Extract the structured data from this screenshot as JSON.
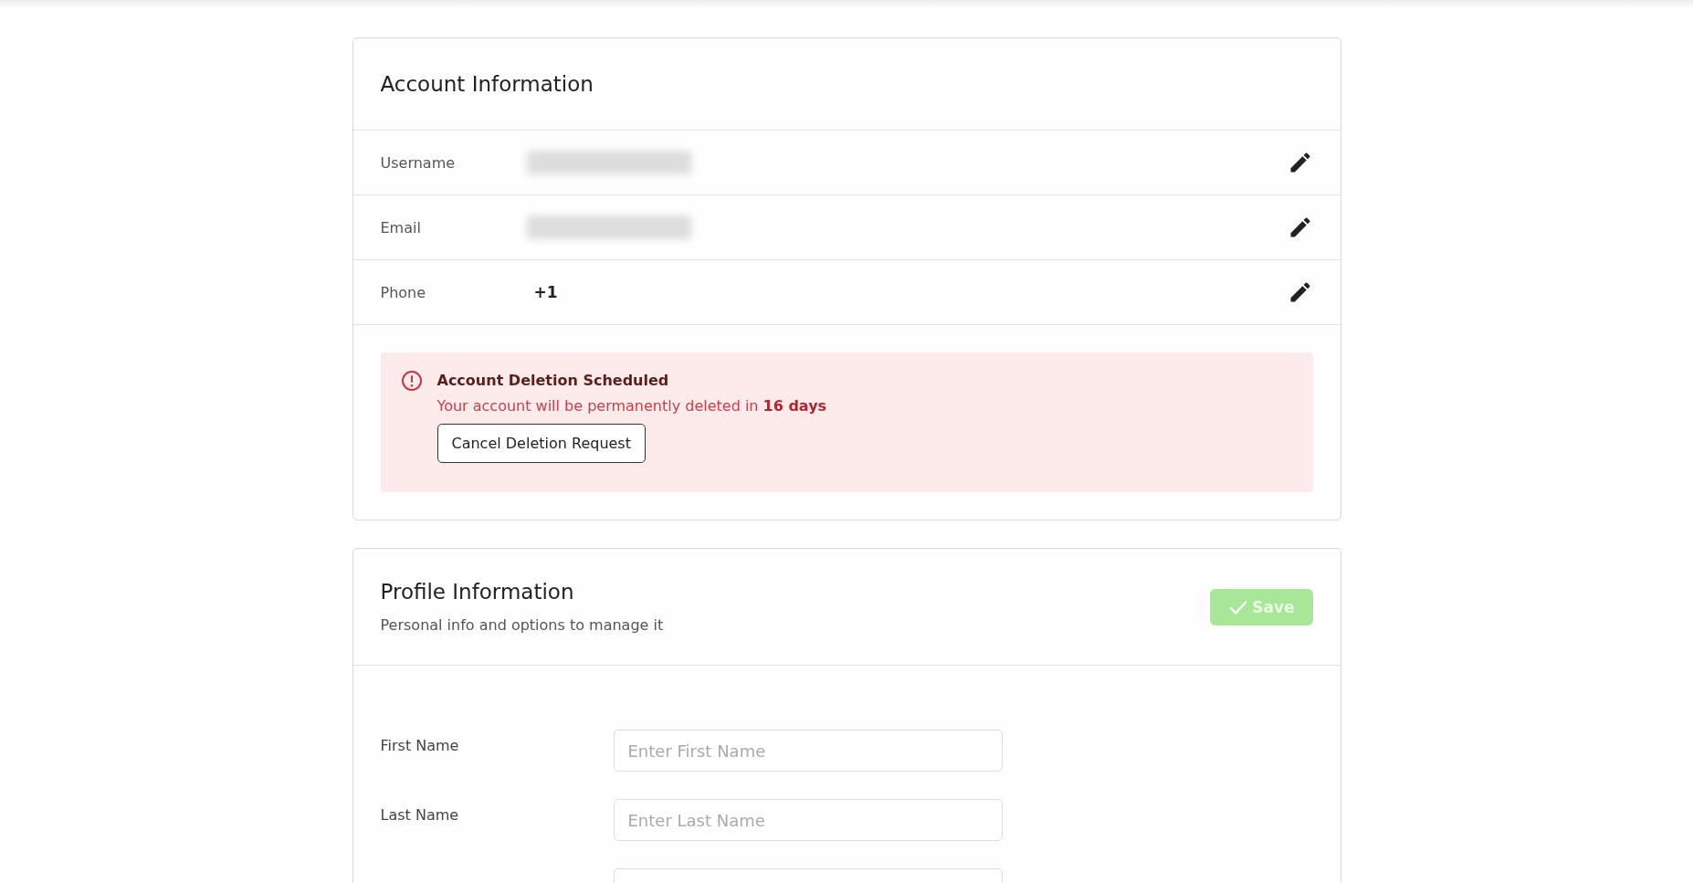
{
  "account": {
    "title": "Account Information",
    "rows": [
      {
        "label": "Username",
        "kind": "redacted"
      },
      {
        "label": "Email",
        "kind": "redacted"
      },
      {
        "label": "Phone",
        "kind": "text",
        "value": "+1"
      }
    ],
    "alert": {
      "title": "Account Deletion Scheduled",
      "message": "Your account will be permanently deleted in **16 days**",
      "button": "Cancel Deletion Request"
    }
  },
  "profile": {
    "title": "Profile Information",
    "subtitle": "Personal info and options to manage it",
    "save": {
      "label": "Save",
      "disabled": true
    },
    "fields": [
      {
        "label": "First Name",
        "placeholder": "Enter First Name"
      },
      {
        "label": "Last Name",
        "placeholder": "Enter Last Name"
      }
    ]
  }
}
